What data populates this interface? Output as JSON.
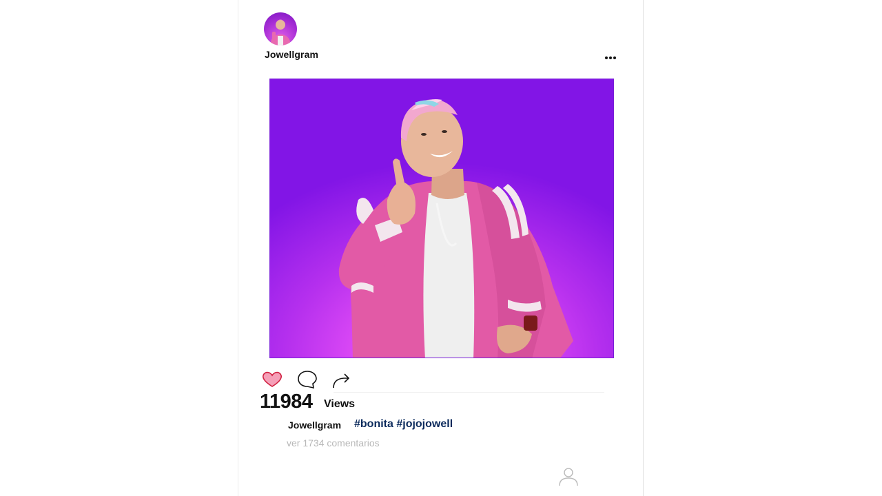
{
  "post": {
    "username": "Jowellgram",
    "more_icon": "more-horizontal-icon",
    "photo_description_icon": "photo"
  },
  "actions": {
    "like_icon": "heart-icon",
    "like_color": "#f5a0b8",
    "comment_icon": "comment-bubble-icon",
    "share_icon": "share-arrow-icon"
  },
  "stats": {
    "views_count": "11984",
    "views_label": "Views"
  },
  "caption": {
    "username": "Jowellgram",
    "hashtags": [
      "#bonita",
      "#jojojowell"
    ],
    "hashtag_color": "#0b2a5c"
  },
  "comments": {
    "link_text": "ver 1734 comentarios"
  },
  "footer": {
    "profile_icon": "user-profile-icon"
  }
}
